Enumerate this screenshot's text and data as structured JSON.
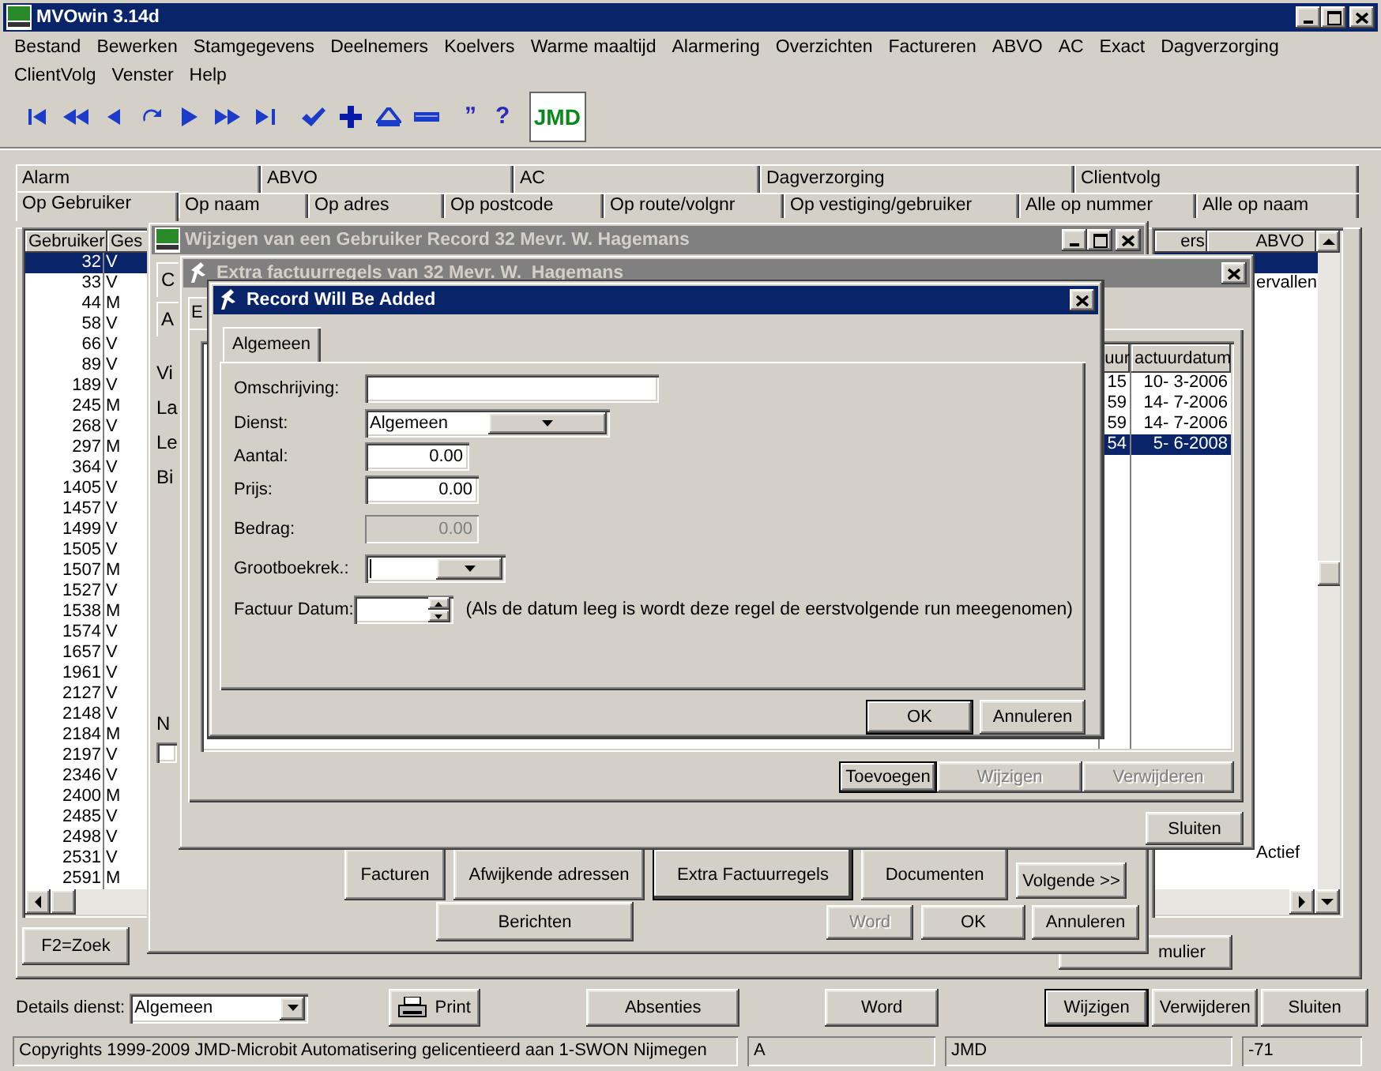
{
  "window": {
    "title": "MVOwin 3.14d"
  },
  "menu": [
    {
      "label": "Bestand"
    },
    {
      "label": "Bewerken"
    },
    {
      "label": "Stamgegevens"
    },
    {
      "label": "Deelnemers"
    },
    {
      "label": "Koelvers"
    },
    {
      "label": "Warme maaltijd"
    },
    {
      "label": "Alarmering"
    },
    {
      "label": "Overzichten"
    },
    {
      "label": "Factureren"
    },
    {
      "label": "ABVO"
    },
    {
      "label": "AC"
    },
    {
      "label": "Exact"
    },
    {
      "label": "Dagverzorging"
    },
    {
      "label": "ClientVolg"
    },
    {
      "label": "Venster"
    },
    {
      "label": "Help"
    }
  ],
  "toolbar": [
    {
      "kind": "first"
    },
    {
      "kind": "prev_page"
    },
    {
      "kind": "prev"
    },
    {
      "kind": "refresh"
    },
    {
      "kind": "next"
    },
    {
      "kind": "next_page"
    },
    {
      "kind": "last"
    },
    {
      "kind": "check"
    },
    {
      "kind": "plus"
    },
    {
      "kind": "up"
    },
    {
      "kind": "minus"
    },
    {
      "kind": "glyph",
      "glyph": "”"
    },
    {
      "kind": "glyph",
      "glyph": "?"
    },
    {
      "kind": "logo",
      "text": "JMD"
    }
  ],
  "category_tabs": [
    {
      "label": "Alarm"
    },
    {
      "label": "ABVO"
    },
    {
      "label": "AC"
    },
    {
      "label": "Dagverzorging"
    },
    {
      "label": "Clientvolg"
    }
  ],
  "index_tabs": [
    {
      "label": "Op Gebruiker",
      "selected": true
    },
    {
      "label": "Op naam",
      "selected": false
    },
    {
      "label": "Op adres",
      "selected": false
    },
    {
      "label": "Op postcode",
      "selected": false
    },
    {
      "label": "Op route/volgnr",
      "selected": false
    },
    {
      "label": "Op vestiging/gebruiker",
      "selected": false
    },
    {
      "label": "Alle op nummer",
      "selected": false
    },
    {
      "label": "Alle op naam",
      "selected": false
    }
  ],
  "user_list": {
    "columns": [
      "Gebruiker",
      "Ges"
    ],
    "rows": [
      {
        "cells": [
          "32",
          "V"
        ],
        "selected": true
      },
      {
        "cells": [
          "33",
          "V"
        ],
        "selected": false
      },
      {
        "cells": [
          "44",
          "M"
        ],
        "selected": false
      },
      {
        "cells": [
          "58",
          "V"
        ],
        "selected": false
      },
      {
        "cells": [
          "66",
          "V"
        ],
        "selected": false
      },
      {
        "cells": [
          "89",
          "V"
        ],
        "selected": false
      },
      {
        "cells": [
          "189",
          "V"
        ],
        "selected": false
      },
      {
        "cells": [
          "245",
          "M"
        ],
        "selected": false
      },
      {
        "cells": [
          "268",
          "V"
        ],
        "selected": false
      },
      {
        "cells": [
          "297",
          "M"
        ],
        "selected": false
      },
      {
        "cells": [
          "364",
          "V"
        ],
        "selected": false
      },
      {
        "cells": [
          "1405",
          "V"
        ],
        "selected": false
      },
      {
        "cells": [
          "1457",
          "V"
        ],
        "selected": false
      },
      {
        "cells": [
          "1499",
          "V"
        ],
        "selected": false
      },
      {
        "cells": [
          "1505",
          "V"
        ],
        "selected": false
      },
      {
        "cells": [
          "1507",
          "M"
        ],
        "selected": false
      },
      {
        "cells": [
          "1527",
          "V"
        ],
        "selected": false
      },
      {
        "cells": [
          "1538",
          "M"
        ],
        "selected": false
      },
      {
        "cells": [
          "1574",
          "V"
        ],
        "selected": false
      },
      {
        "cells": [
          "1657",
          "V"
        ],
        "selected": false
      },
      {
        "cells": [
          "1961",
          "V"
        ],
        "selected": false
      },
      {
        "cells": [
          "2127",
          "V"
        ],
        "selected": false
      },
      {
        "cells": [
          "2148",
          "V"
        ],
        "selected": false
      },
      {
        "cells": [
          "2184",
          "M"
        ],
        "selected": false
      },
      {
        "cells": [
          "2197",
          "V"
        ],
        "selected": false
      },
      {
        "cells": [
          "2346",
          "V"
        ],
        "selected": false
      },
      {
        "cells": [
          "2400",
          "M"
        ],
        "selected": false
      },
      {
        "cells": [
          "2485",
          "V"
        ],
        "selected": false
      },
      {
        "cells": [
          "2498",
          "V"
        ],
        "selected": false
      },
      {
        "cells": [
          "2531",
          "V"
        ],
        "selected": false
      },
      {
        "cells": [
          "2591",
          "M"
        ],
        "selected": false
      }
    ]
  },
  "right_list": {
    "columns": [
      "ers",
      "ABVO"
    ],
    "rows": [
      {
        "selected": true
      },
      {
        "text": "ervallen",
        "selected": false
      },
      {
        "text": "Actief",
        "selected": false
      }
    ]
  },
  "search_button": "F2=Zoek",
  "hidden_button": "mulier",
  "details": {
    "label": "Details dienst:",
    "value": "Algemeen"
  },
  "bottom_buttons": [
    {
      "label": "Print",
      "kind": "print",
      "default": false
    },
    {
      "label": "Absenties",
      "kind": "plain",
      "default": false
    },
    {
      "label": "Word",
      "kind": "plain",
      "default": false
    },
    {
      "label": "Wijzigen",
      "kind": "plain",
      "default": true
    },
    {
      "label": "Verwijderen",
      "kind": "plain",
      "default": false
    },
    {
      "label": "Sluiten",
      "kind": "plain",
      "default": false
    }
  ],
  "status_bar": [
    "Copyrights 1999-2009 JMD-Microbit Automatisering gelicentieerd aan 1-SWON Nijmegen",
    "A",
    "JMD",
    "-71"
  ],
  "edit_dialog": {
    "title": "Wijzigen van een Gebruiker Record 32 Mevr. W. Hagemans",
    "active": false,
    "tab_fragments": [
      "C",
      "A"
    ],
    "label_fragments": [
      "Vi",
      "La",
      "Le",
      "Bi"
    ],
    "bottom_fragment": "N",
    "checkbox": {
      "checked": false
    },
    "buttons": [
      {
        "label": "Facturen",
        "pressed": false
      },
      {
        "label": "Afwijkende adressen",
        "pressed": false
      },
      {
        "label": "Extra Factuurregels",
        "pressed": true
      },
      {
        "label": "Documenten",
        "pressed": false
      },
      {
        "label": "Volgende >>",
        "pressed": false
      }
    ],
    "footer_buttons": [
      {
        "label": "Berichten",
        "disabled": false
      },
      {
        "label": "Word",
        "disabled": true
      },
      {
        "label": "OK",
        "disabled": false
      },
      {
        "label": "Annuleren",
        "disabled": false
      }
    ]
  },
  "extra_dialog": {
    "title": "Extra factuurregels van 32 Mevr. W.  Hagemans",
    "active": false,
    "tab_fragment": "E",
    "table": {
      "columns": [
        "uur",
        "actuurdatum"
      ],
      "rows": [
        {
          "cells": [
            "15",
            "10- 3-2006"
          ],
          "selected": false
        },
        {
          "cells": [
            "59",
            "14- 7-2006"
          ],
          "selected": false
        },
        {
          "cells": [
            "59",
            "14- 7-2006"
          ],
          "selected": false
        },
        {
          "cells": [
            "54",
            "5- 6-2008"
          ],
          "selected": true
        }
      ]
    },
    "buttons": [
      {
        "label": "Toevoegen",
        "disabled": false
      },
      {
        "label": "Wijzigen",
        "disabled": true
      },
      {
        "label": "Verwijderen",
        "disabled": true
      }
    ],
    "close_button": "Sluiten"
  },
  "record_dialog": {
    "title": "Record Will Be Added",
    "active": true,
    "tab": "Algemeen",
    "fields": [
      {
        "label": "Omschrijving:",
        "kind": "text"
      },
      {
        "label": "Dienst:",
        "kind": "select",
        "value": "Algemeen"
      },
      {
        "label": "Aantal:",
        "kind": "number",
        "value": "0.00",
        "disabled": false
      },
      {
        "label": "Prijs:",
        "kind": "number",
        "value": "0.00",
        "disabled": false
      },
      {
        "label": "Bedrag:",
        "kind": "number",
        "value": "0.00",
        "disabled": true
      },
      {
        "label": "Grootboekrek.:",
        "kind": "select"
      },
      {
        "label": "Factuur Datum:",
        "kind": "date",
        "note": "(Als de datum leeg is wordt deze regel de eerstvolgende run meegenomen)"
      }
    ],
    "buttons": [
      {
        "label": "OK",
        "default": true
      },
      {
        "label": "Annuleren",
        "default": false
      }
    ]
  }
}
